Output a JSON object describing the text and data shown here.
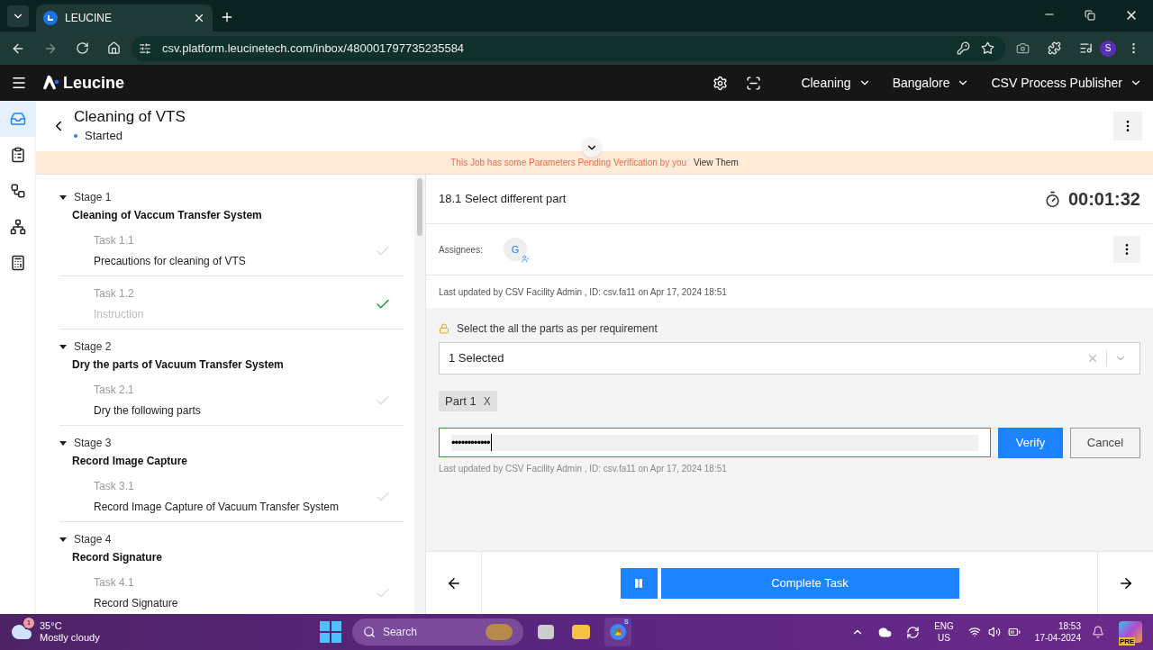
{
  "browser": {
    "tab_title": "LEUCINE",
    "url": "csv.platform.leucinetech.com/inbox/480001797735235584",
    "profile_initial": "S"
  },
  "app": {
    "brand": "Leucine",
    "nav": [
      "Cleaning",
      "Bangalore",
      "CSV Process Publisher"
    ]
  },
  "rail": [
    {
      "kind": "inbox",
      "selected": true
    },
    {
      "kind": "checklist",
      "selected": false
    },
    {
      "kind": "workflow",
      "selected": false
    },
    {
      "kind": "hierarchy",
      "selected": false
    },
    {
      "kind": "report",
      "selected": false
    }
  ],
  "job": {
    "title": "Cleaning of VTS",
    "status": "Started"
  },
  "banner": {
    "message": "This Job has some Parameters Pending Verification by you",
    "link": "View Them"
  },
  "stages": [
    {
      "label": "Stage 1",
      "name": "Cleaning of Vaccum Transfer System",
      "expanded": true,
      "tasks": [
        {
          "label": "Task 1.1",
          "name": "Precautions for cleaning of VTS",
          "completed": false
        },
        {
          "label": "Task 1.2",
          "name": "Instruction",
          "completed": true
        }
      ]
    },
    {
      "label": "Stage 2",
      "name": "Dry the parts of Vacuum Transfer System",
      "expanded": true,
      "tasks": [
        {
          "label": "Task 2.1",
          "name": "Dry the following parts",
          "completed": false
        }
      ]
    },
    {
      "label": "Stage 3",
      "name": "Record Image Capture",
      "expanded": true,
      "tasks": [
        {
          "label": "Task 3.1",
          "name": "Record Image Capture of Vacuum Transfer System",
          "completed": false
        }
      ]
    },
    {
      "label": "Stage 4",
      "name": "Record Signature",
      "expanded": true,
      "tasks": [
        {
          "label": "Task 4.1",
          "name": "Record Signature",
          "completed": false
        }
      ]
    }
  ],
  "task_panel": {
    "title": "18.1 Select different part",
    "timer": "00:01:32",
    "assignees_label": "Assignees:",
    "assignee_initial": "G",
    "last_updated": "Last updated by CSV Facility Admin , ID: csv.fa11 on Apr 17, 2024 18:51",
    "parameter": {
      "label": "Select the all the parts as per requirement",
      "locked": true,
      "select_value": "1 Selected",
      "chips": [
        "Part 1"
      ],
      "chip_remove": "X",
      "verify_value": "••••••••••••",
      "verify_button": "Verify",
      "cancel_button": "Cancel",
      "last_updated": "Last updated by CSV Facility Admin , ID: csv.fa11 on Apr 17, 2024 18:51"
    }
  },
  "footer": {
    "complete_button": "Complete Task"
  },
  "taskbar": {
    "weather_badge": "1",
    "temperature": "35°C",
    "weather": "Mostly cloudy",
    "search_placeholder": "Search",
    "chrome_badge": "S",
    "language": "ENG",
    "region": "US",
    "time": "18:53",
    "date": "17-04-2024",
    "copilot_badge": "PRE"
  }
}
